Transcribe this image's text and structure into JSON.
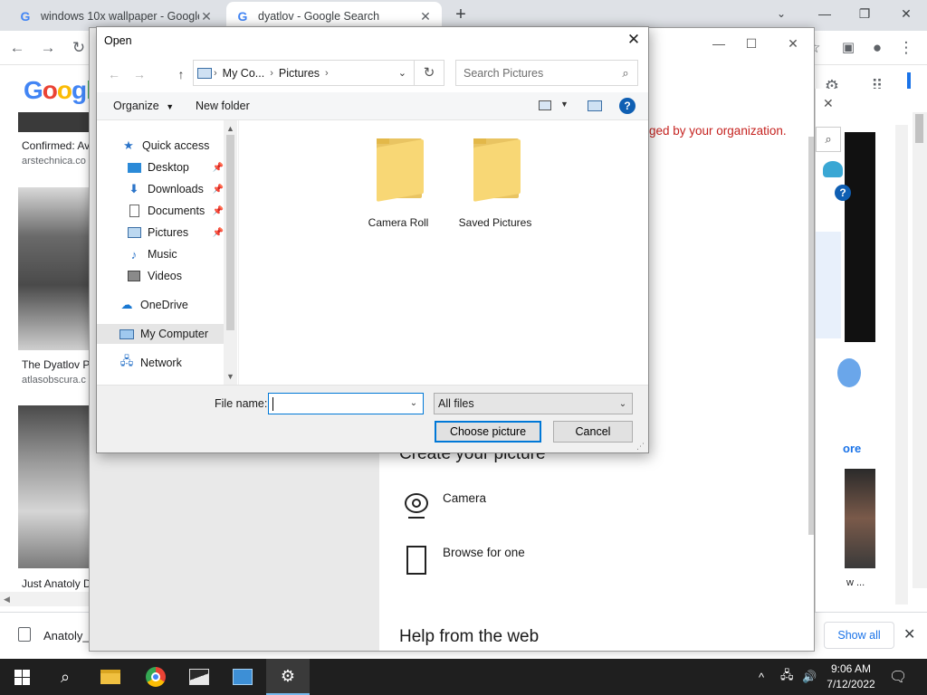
{
  "browser": {
    "tabs": [
      {
        "title": "windows 10x wallpaper - Google"
      },
      {
        "title": "dyatlov - Google Search"
      }
    ],
    "new_tab": "+",
    "logo": "Googl",
    "results": [
      {
        "title": "Confirmed: Av",
        "source": "arstechnica.co"
      },
      {
        "title": "The Dyatlov P",
        "source": "atlasobscura.c"
      },
      {
        "title": "Just Anatoly D",
        "source": ""
      }
    ],
    "download_name": "Anatoly_",
    "show_all": "Show all",
    "right_fragment": "ore",
    "right_fragment_2": "w ..."
  },
  "settings": {
    "managed_text": "ged by your organization.",
    "create_heading": "Create your picture",
    "camera_label": "Camera",
    "browse_label": "Browse for one",
    "help_heading": "Help from the web"
  },
  "dialog": {
    "title": "Open",
    "address": [
      "My Co...",
      "Pictures"
    ],
    "search_placeholder": "Search Pictures",
    "organize_label": "Organize",
    "new_folder_label": "New folder",
    "nav": [
      {
        "label": "Quick access",
        "icon": "star-icon"
      },
      {
        "label": "Desktop",
        "icon": "desktop-icon",
        "pinned": true
      },
      {
        "label": "Downloads",
        "icon": "download-icon",
        "pinned": true
      },
      {
        "label": "Documents",
        "icon": "document-icon",
        "pinned": true
      },
      {
        "label": "Pictures",
        "icon": "pictures-icon",
        "pinned": true
      },
      {
        "label": "Music",
        "icon": "music-icon"
      },
      {
        "label": "Videos",
        "icon": "video-icon"
      },
      {
        "label": "OneDrive",
        "icon": "cloud-icon"
      },
      {
        "label": "My Computer",
        "icon": "computer-icon",
        "selected": true
      },
      {
        "label": "Network",
        "icon": "network-icon"
      }
    ],
    "folders": [
      {
        "label": "Camera Roll"
      },
      {
        "label": "Saved Pictures"
      }
    ],
    "file_name_label": "File name:",
    "file_name_value": "",
    "filter_value": "All files",
    "choose_label": "Choose picture",
    "cancel_label": "Cancel"
  },
  "taskbar": {
    "time": "9:06 AM",
    "date": "7/12/2022"
  },
  "colors": {
    "accent": "#0078d7",
    "folder": "#f8d775",
    "managed_red": "#c5221f"
  }
}
